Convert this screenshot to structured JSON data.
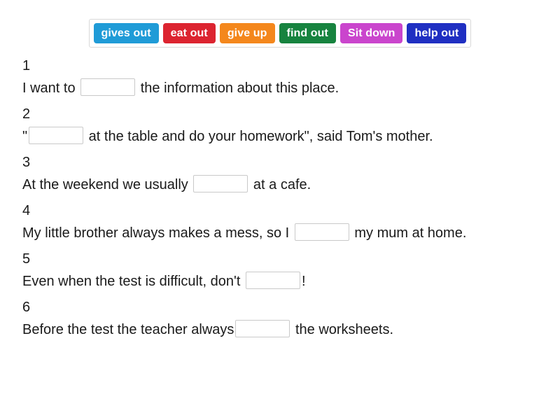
{
  "wordbank": {
    "name": "word-bank",
    "chips": [
      {
        "label": "gives out",
        "color": "#1f9bd7"
      },
      {
        "label": "eat out",
        "color": "#dc2430"
      },
      {
        "label": "give up",
        "color": "#f4871c"
      },
      {
        "label": "find out",
        "color": "#17833f"
      },
      {
        "label": "Sit down",
        "color": "#ca45cd"
      },
      {
        "label": "help out",
        "color": "#1f2fc2"
      }
    ]
  },
  "questions": [
    {
      "number": "1",
      "before": "I want to ",
      "after": " the information about this place.",
      "blank_value": ""
    },
    {
      "number": "2",
      "before": "\"",
      "after": " at the table and do your homework\", said Tom's mother.",
      "blank_value": ""
    },
    {
      "number": "3",
      "before": "At the weekend we usually ",
      "after": " at a cafe.",
      "blank_value": ""
    },
    {
      "number": "4",
      "before": "My little brother always makes a mess, so I ",
      "after": " my mum at home.",
      "blank_value": ""
    },
    {
      "number": "5",
      "before": "Even when the test is difficult, don't ",
      "after": "!",
      "blank_value": ""
    },
    {
      "number": "6",
      "before": "Before the test the teacher always",
      "after": " the worksheets.",
      "blank_value": ""
    }
  ]
}
